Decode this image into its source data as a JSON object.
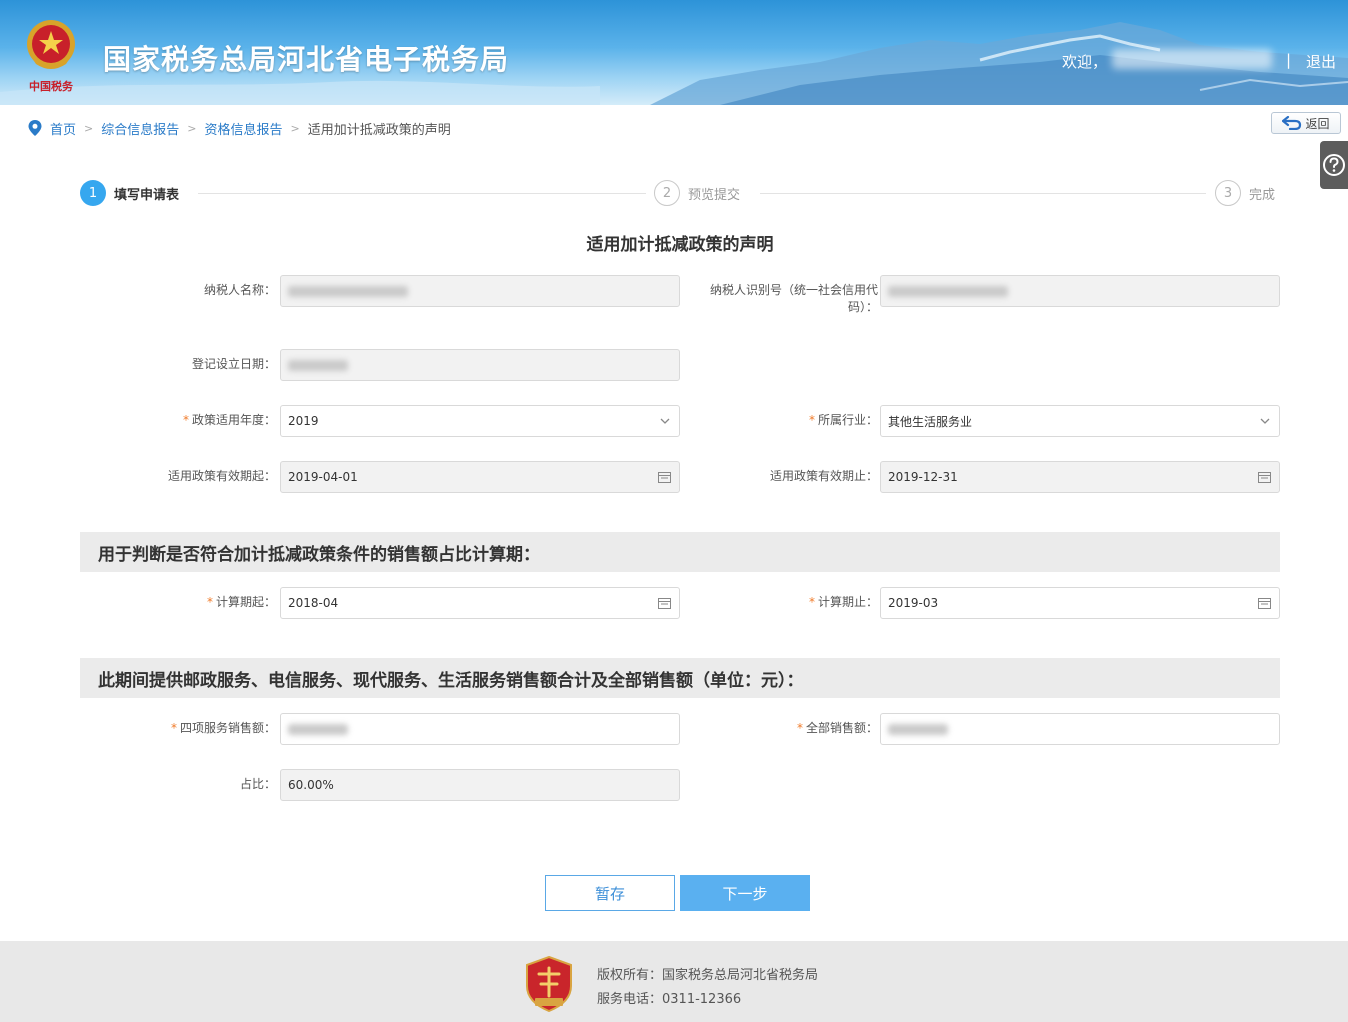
{
  "header": {
    "title": "国家税务总局河北省电子税务局",
    "welcome": "欢迎，",
    "separator": "|",
    "logout": "退出"
  },
  "breadcrumb": {
    "home": "首页",
    "level1": "综合信息报告",
    "level2": "资格信息报告",
    "current": "适用加计抵减政策的声明",
    "back": "返回"
  },
  "steps": [
    {
      "num": "1",
      "label": "填写申请表"
    },
    {
      "num": "2",
      "label": "预览提交"
    },
    {
      "num": "3",
      "label": "完成"
    }
  ],
  "form": {
    "title": "适用加计抵减政策的声明",
    "taxpayer_name_label": "纳税人名称：",
    "taxpayer_id_label_1": "纳税人识别号（统一社会信用代",
    "taxpayer_id_label_2": "码）：",
    "reg_date_label": "登记设立日期：",
    "policy_year_label": "政策适用年度：",
    "policy_year_value": "2019",
    "industry_label": "所属行业：",
    "industry_value": "其他生活服务业",
    "valid_start_label": "适用政策有效期起：",
    "valid_start_value": "2019-04-01",
    "valid_end_label": "适用政策有效期止：",
    "valid_end_value": "2019-12-31",
    "required_mark": "*"
  },
  "section1": {
    "title": "用于判断是否符合加计抵减政策条件的销售额占比计算期：",
    "calc_start_label": "计算期起：",
    "calc_start_value": "2018-04",
    "calc_end_label": "计算期止：",
    "calc_end_value": "2019-03"
  },
  "section2": {
    "title": "此期间提供邮政服务、电信服务、现代服务、生活服务销售额合计及全部销售额（单位：元）：",
    "four_services_label": "四项服务销售额：",
    "total_sales_label": "全部销售额：",
    "ratio_label": "占比：",
    "ratio_value": "60.00%"
  },
  "buttons": {
    "save": "暂存",
    "next": "下一步"
  },
  "footer": {
    "copyright": "版权所有：国家税务总局河北省税务局",
    "phone": "服务电话：0311-12366"
  },
  "colors": {
    "primary": "#36a7ef",
    "link": "#2a7bc8",
    "required": "#f07b2a"
  }
}
